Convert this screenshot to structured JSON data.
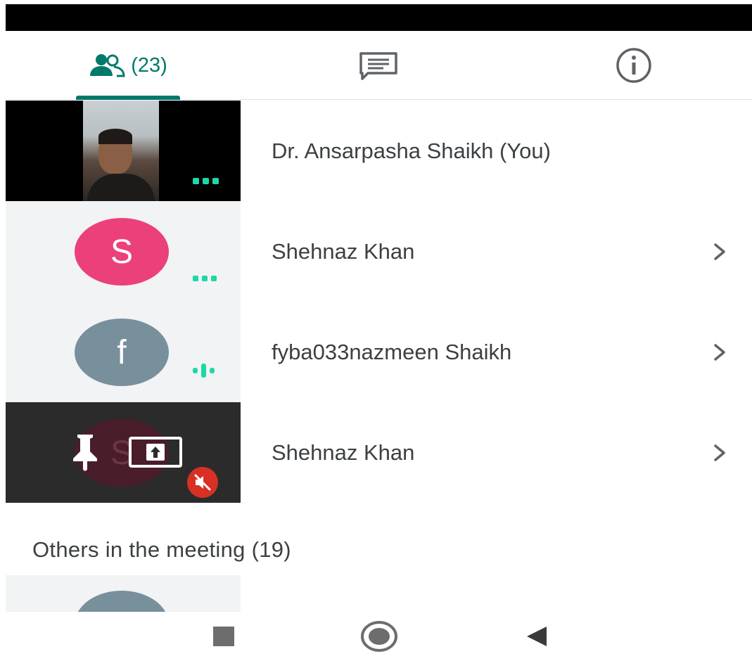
{
  "tabs": {
    "people_count": "(23)",
    "people_icon": "people-icon",
    "chat_icon": "chat-icon",
    "info_icon": "info-icon"
  },
  "participants": [
    {
      "name": "Dr. Ansarpasha Shaikh (You)",
      "tile": "video"
    },
    {
      "name": "Shehnaz Khan",
      "initial": "S",
      "avatar_color": "#ec407a"
    },
    {
      "name": "fyba033nazmeen Shaikh",
      "initial": "f",
      "avatar_color": "#78909c"
    },
    {
      "name": "Shehnaz Khan",
      "initial": "S",
      "status": [
        "pinned",
        "presenting",
        "muted"
      ]
    }
  ],
  "others_section": {
    "title": "Others in the meeting (19)"
  },
  "colors": {
    "accent": "#00796b",
    "audio_indicator": "#1ed7a8",
    "mute_badge": "#d93025"
  },
  "nav": {
    "icons": [
      "recents-icon",
      "home-icon",
      "back-icon"
    ]
  }
}
